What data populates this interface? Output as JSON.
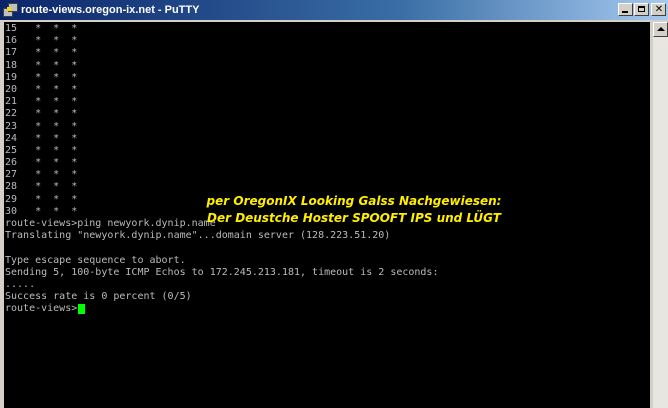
{
  "window": {
    "title": "route-views.oregon-ix.net - PuTTY",
    "icon": "putty-icon",
    "buttons": {
      "minimize": "minimize-icon",
      "maximize": "maximize-icon",
      "close": "close-icon"
    }
  },
  "terminal": {
    "lines": [
      "15   *  *  *",
      "16   *  *  *",
      "17   *  *  *",
      "18   *  *  *",
      "19   *  *  *",
      "20   *  *  *",
      "21   *  *  *",
      "22   *  *  *",
      "23   *  *  *",
      "24   *  *  *",
      "25   *  *  *",
      "26   *  *  *",
      "27   *  *  *",
      "28   *  *  *",
      "29   *  *  *",
      "30   *  *  *",
      "route-views>ping newyork.dynip.name",
      "Translating \"newyork.dynip.name\"...domain server (128.223.51.20)",
      "",
      "Type escape sequence to abort.",
      "Sending 5, 100-byte ICMP Echos to 172.245.213.181, timeout is 2 seconds:",
      ".....",
      "Success rate is 0 percent (0/5)"
    ],
    "prompt": "route-views>",
    "colors": {
      "background": "#000000",
      "text": "#bbbbbb",
      "cursor": "#00ff00"
    }
  },
  "overlay": {
    "line1": "per OregonIX Looking Galss Nachgewiesen:",
    "line2": "Der Deustche Hoster SPOOFT IPS und LÜGT",
    "color": "#ffee00"
  },
  "scrollbar": {
    "up_arrow": "scroll-up-arrow-icon"
  }
}
